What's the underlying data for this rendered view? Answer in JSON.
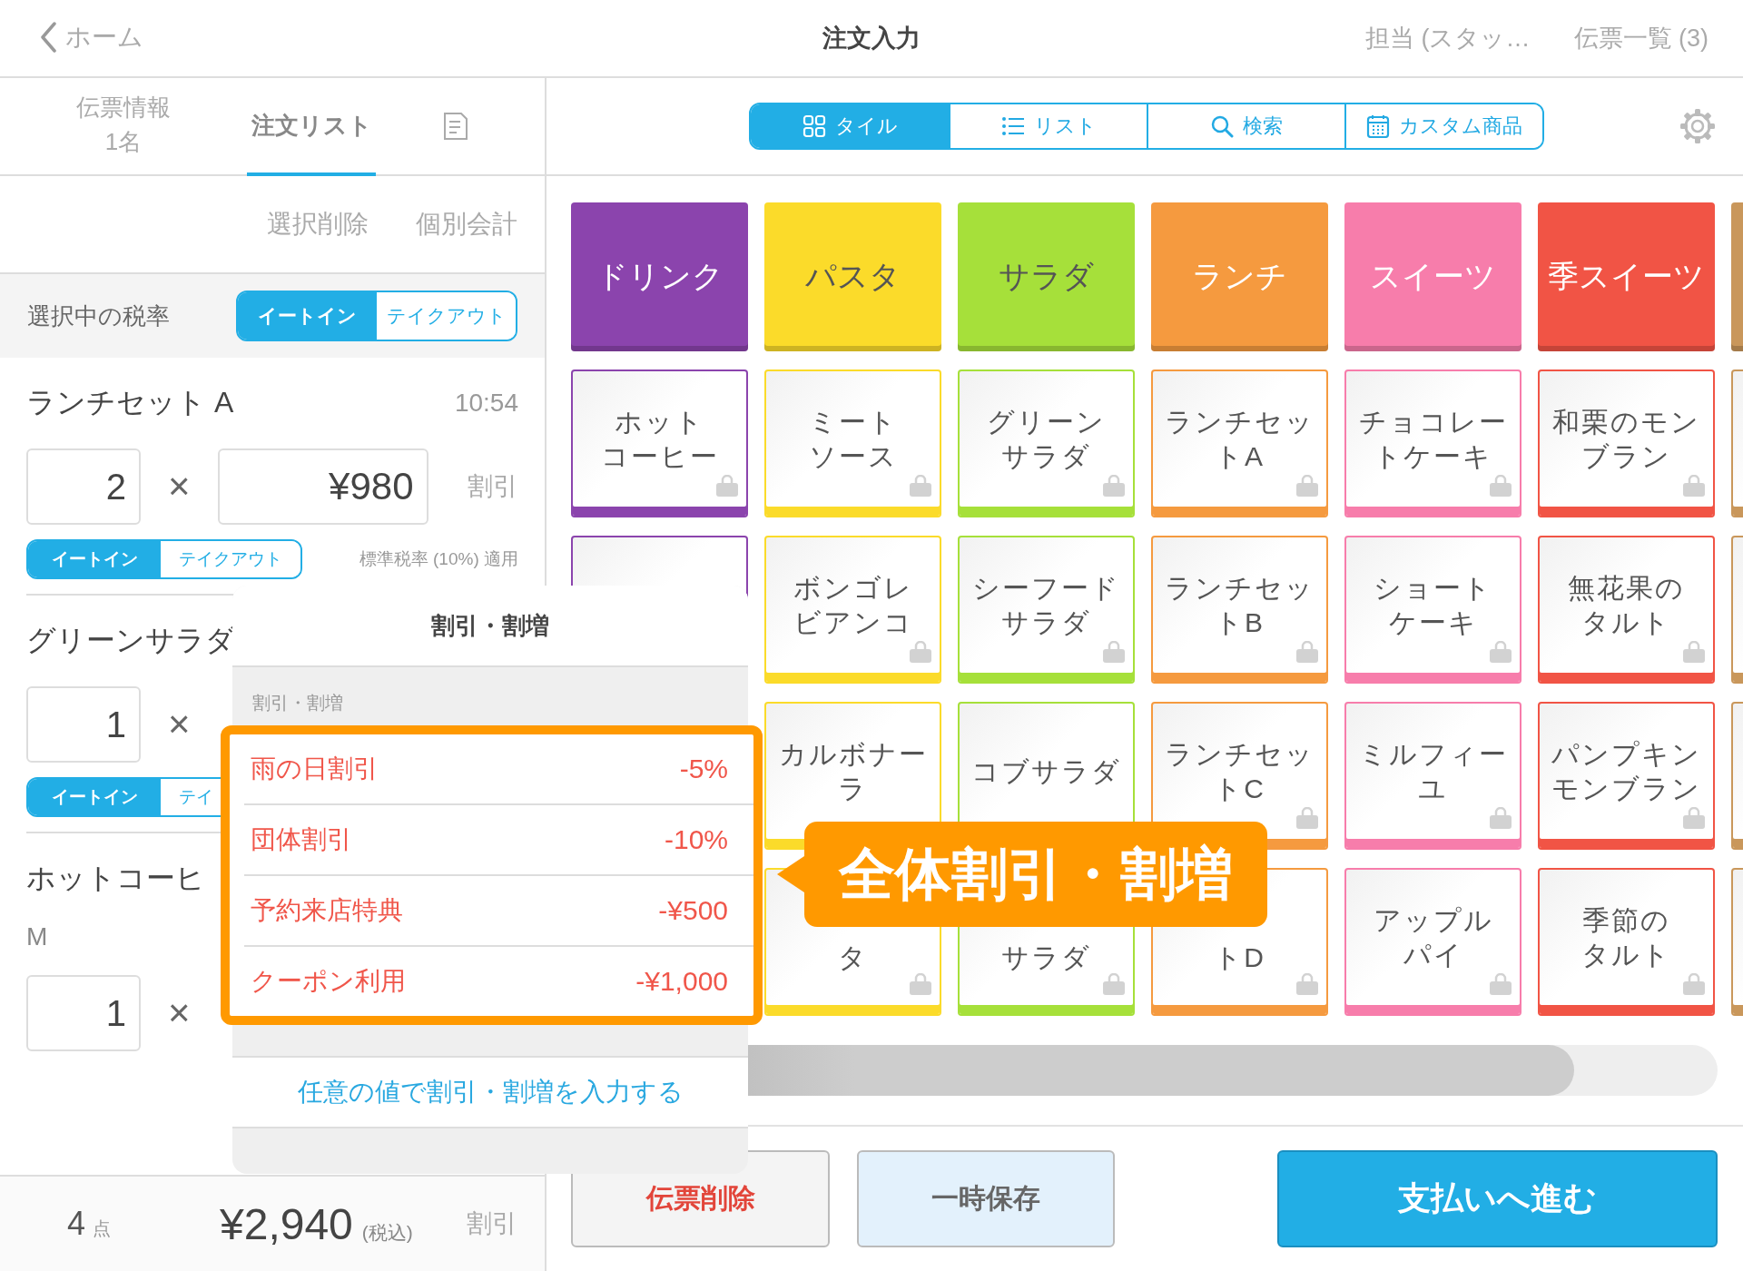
{
  "header": {
    "back": "ホーム",
    "title": "注文入力",
    "staff": "担当 (スタッ…",
    "slips": "伝票一覧 (3)"
  },
  "left_tabs": [
    {
      "label": "伝票情報",
      "sub": "1名",
      "selected": false
    },
    {
      "label": "注文リスト",
      "selected": true
    }
  ],
  "actions": [
    "選択削除",
    "個別会計"
  ],
  "tax_rate": {
    "label": "選択中の税率",
    "options": [
      {
        "label": "イートイン",
        "selected": true
      },
      {
        "label": "テイクアウト",
        "selected": false
      }
    ]
  },
  "order_items": [
    {
      "name": "ランチセット A",
      "time": "10:54",
      "qty": "2",
      "times": "×",
      "price": "¥980",
      "discount": "割引",
      "options": [
        {
          "label": "イートイン",
          "selected": true
        },
        {
          "label": "テイクアウト",
          "selected": false
        }
      ],
      "tax_note": "標準税率 (10%) 適用"
    },
    {
      "name": "グリーンサラダ",
      "qty": "1",
      "times": "×",
      "options": [
        {
          "label": "イートイン",
          "selected": true
        },
        {
          "label": "テイ",
          "selected": false
        }
      ]
    },
    {
      "name": "ホットコーヒ",
      "option": "M",
      "qty": "1",
      "times": "×"
    }
  ],
  "footer": {
    "count": "4",
    "unit": "点",
    "total": "¥2,940",
    "tax_note": "(税込)",
    "discount": "割引"
  },
  "view_tabs": [
    {
      "label": "タイル",
      "kind": "tile",
      "selected": true
    },
    {
      "label": "リスト",
      "kind": "list",
      "selected": false
    },
    {
      "label": "検索",
      "kind": "search",
      "selected": false
    },
    {
      "label": "カスタム商品",
      "kind": "custom",
      "selected": false
    }
  ],
  "categories": [
    {
      "name": "ドリンク",
      "color": "#8b44ad",
      "items": [
        {
          "lines": [
            "ホット",
            "コーヒー"
          ]
        },
        {
          "kind": "blank"
        }
      ]
    },
    {
      "name": "パスタ",
      "color": "#fbdb2a",
      "items": [
        {
          "lines": [
            "ミート",
            "ソース"
          ]
        },
        {
          "lines": [
            "ボンゴレ",
            "ビアンコ"
          ]
        },
        {
          "lines": [
            "カルボナー",
            "ラ"
          ],
          "icon": false
        },
        {
          "kind": "lower",
          "lines": [
            "タ"
          ]
        }
      ]
    },
    {
      "name": "サラダ",
      "color": "#a6e03a",
      "items": [
        {
          "lines": [
            "グリーン",
            "サラダ"
          ]
        },
        {
          "lines": [
            "シーフード",
            "サラダ"
          ]
        },
        {
          "lines": [
            "コブサラダ"
          ],
          "icon": false
        },
        {
          "kind": "lower",
          "lines": [
            "サラダ"
          ]
        }
      ]
    },
    {
      "name": "ランチ",
      "color": "#f59a3f",
      "items": [
        {
          "lines": [
            "ランチセッ",
            "トA"
          ]
        },
        {
          "lines": [
            "ランチセッ",
            "トB"
          ]
        },
        {
          "lines": [
            "ランチセッ",
            "トC"
          ]
        },
        {
          "kind": "lower",
          "lines": [
            "トD"
          ]
        }
      ]
    },
    {
      "name": "スイーツ",
      "color": "#f77dab",
      "items": [
        {
          "lines": [
            "チョコレー",
            "トケーキ"
          ]
        },
        {
          "lines": [
            "ショート",
            "ケーキ"
          ]
        },
        {
          "lines": [
            "ミルフィー",
            "ユ"
          ]
        },
        {
          "lines": [
            "アップル",
            "パイ"
          ]
        }
      ]
    },
    {
      "name": "季スイーツ",
      "color": "#f15445",
      "items": [
        {
          "lines": [
            "和栗のモン",
            "ブラン"
          ]
        },
        {
          "lines": [
            "無花果の",
            "タルト"
          ]
        },
        {
          "lines": [
            "パンプキン",
            "モンブラン"
          ]
        },
        {
          "lines": [
            "季節の",
            "タルト"
          ]
        }
      ]
    },
    {
      "color": "#c9975b",
      "items": [
        {
          "kind": "blank"
        },
        {
          "kind": "blank"
        },
        {
          "kind": "blank"
        },
        {
          "kind": "blank"
        }
      ]
    }
  ],
  "buttons": [
    {
      "label": "伝票削除",
      "kind": "danger"
    },
    {
      "label": "一時保存",
      "kind": "secondary"
    },
    {
      "label": "支払いへ進む",
      "kind": "primary"
    }
  ],
  "popup": {
    "title": "割引・割増",
    "section": "割引・割増",
    "options": [
      {
        "label": "雨の日割引",
        "value": "-5%"
      },
      {
        "label": "団体割引",
        "value": "-10%"
      },
      {
        "label": "予約来店特典",
        "value": "-¥500"
      },
      {
        "label": "クーポン利用",
        "value": "-¥1,000"
      }
    ],
    "custom": "任意の値で割引・割増を入力する"
  },
  "callout": "全体割引・割増"
}
